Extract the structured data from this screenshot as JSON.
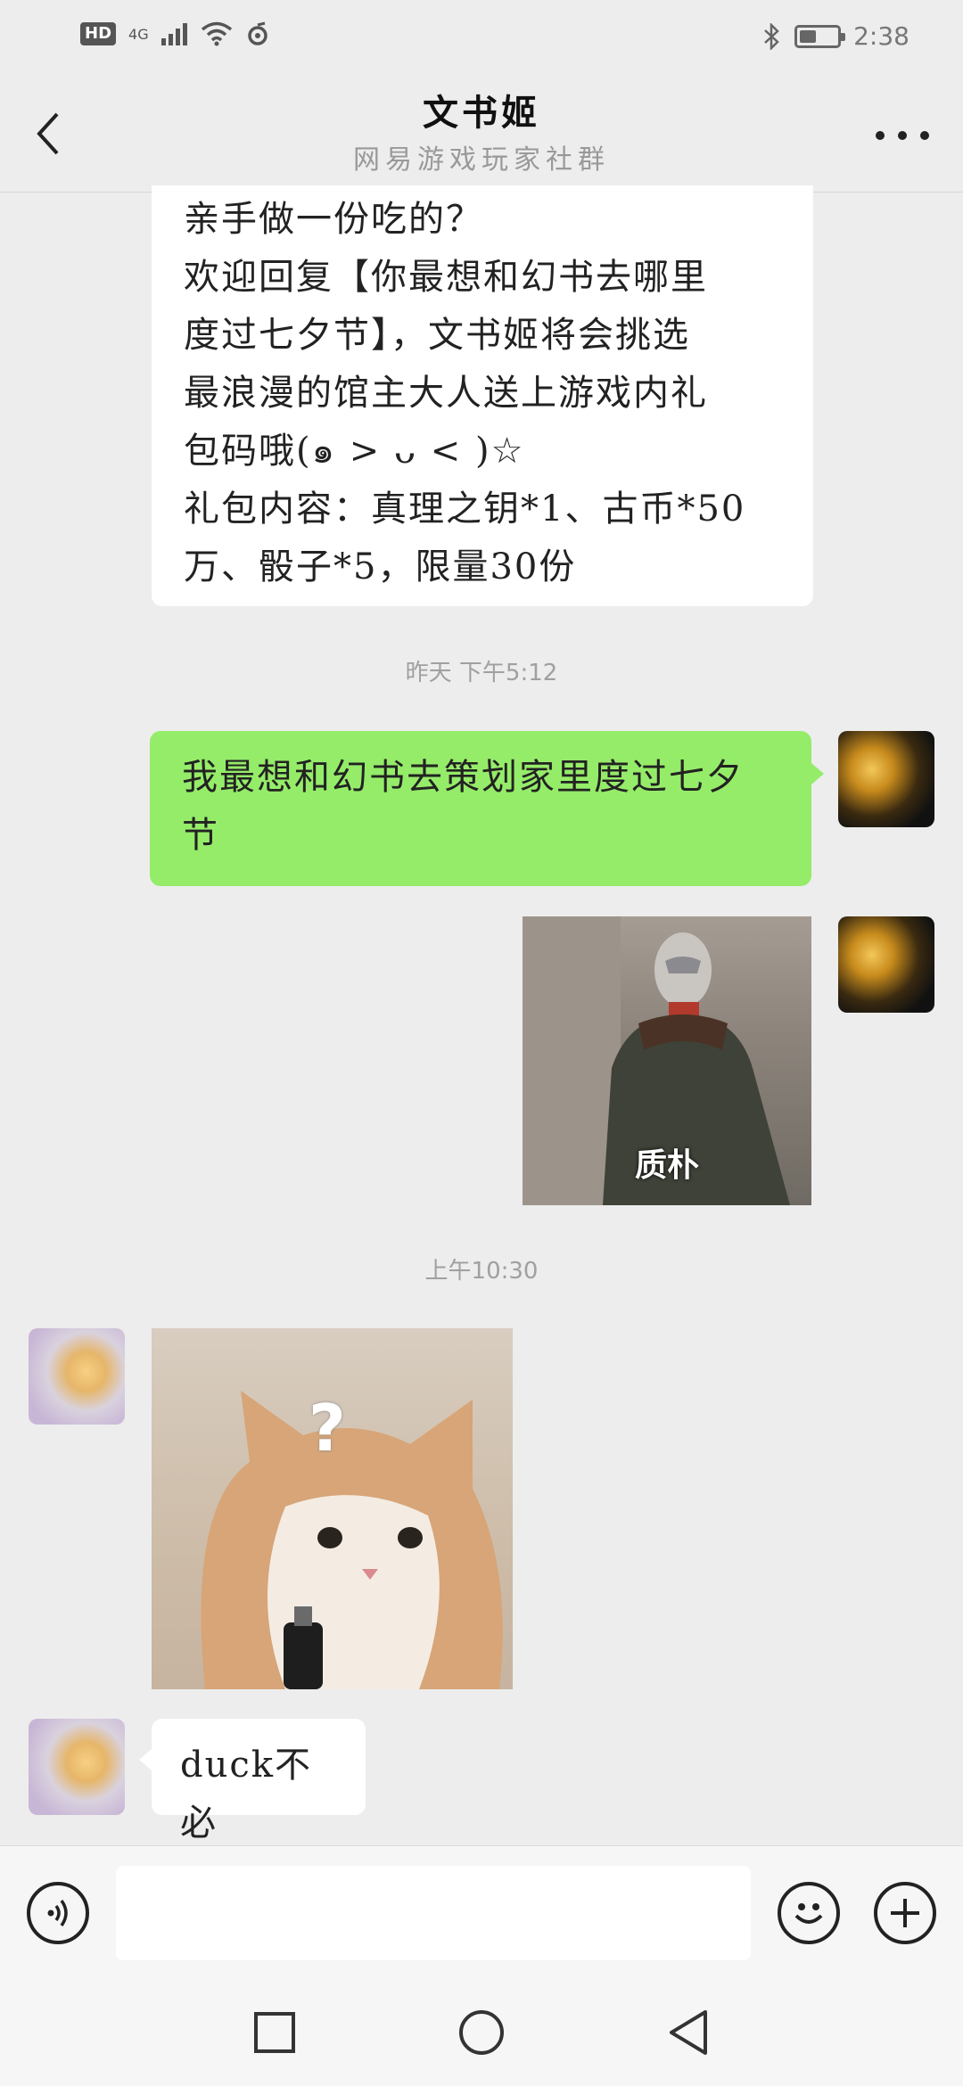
{
  "status_bar": {
    "network_badge": "HD",
    "network_type": "4G",
    "time": "2:38",
    "battery_level": 0.45,
    "icons": [
      "hd-icon",
      "signal-icon",
      "wifi-icon",
      "sync-icon",
      "bluetooth-icon",
      "battery-icon"
    ]
  },
  "header": {
    "title": "文书姬",
    "subtitle": "网易游戏玩家社群"
  },
  "messages": {
    "m1": {
      "lines": [
        "亲手做一份吃的？",
        "欢迎回复【你最想和幻书去哪里",
        "度过七夕节】，文书姬将会挑选",
        "最浪漫的馆主大人送上游戏内礼",
        "包码哦(๑ > ᴗ < )☆",
        "礼包内容：真理之钥*1、古币*50",
        "万、骰子*5，限量30份"
      ]
    },
    "ts1": "昨天 下午5:12",
    "m2": {
      "lines": [
        "我最想和幻书去策划家里度过七夕",
        "节"
      ]
    },
    "m3": {
      "caption": "质朴"
    },
    "ts2": "上午10:30",
    "m4": {
      "mark": "?"
    },
    "m5": {
      "text": "duck不必"
    }
  },
  "input_bar": {
    "placeholder": "",
    "icons": [
      "voice-icon",
      "emoji-icon",
      "plus-icon"
    ]
  },
  "nav_bar": {
    "icons": [
      "recent-apps-icon",
      "home-icon",
      "back-nav-icon"
    ]
  },
  "colors": {
    "background": "#ededed",
    "sent_bubble": "#95ec69",
    "received_bubble": "#ffffff"
  }
}
